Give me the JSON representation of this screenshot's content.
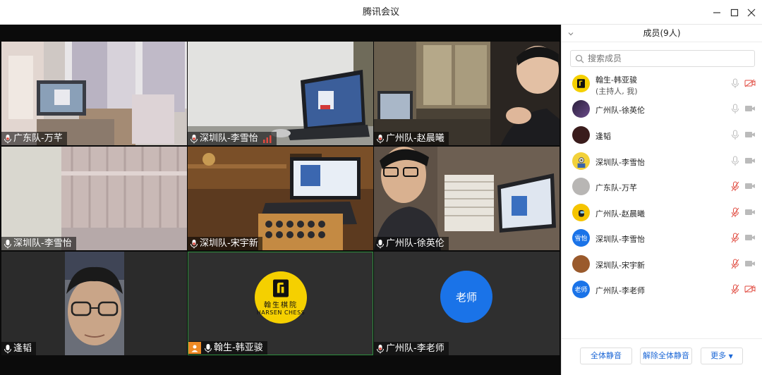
{
  "window": {
    "title": "腾讯会议"
  },
  "tiles": [
    {
      "name": "广东队-万芊",
      "mic": "on",
      "signal": false,
      "kind": "video",
      "scene": "bedroom"
    },
    {
      "name": "深圳队-李雪怡",
      "mic": "on",
      "signal": true,
      "kind": "video",
      "scene": "desk-white"
    },
    {
      "name": "广州队-赵晨曦",
      "mic": "on",
      "signal": false,
      "kind": "video",
      "scene": "person-right"
    },
    {
      "name": "深圳队-李雪怡",
      "mic": "on",
      "signal": false,
      "kind": "video",
      "scene": "curtain"
    },
    {
      "name": "深圳队-宋宇新",
      "mic": "on",
      "signal": false,
      "kind": "video",
      "scene": "desk-warm"
    },
    {
      "name": "广州队-徐英伦",
      "mic": "on",
      "signal": false,
      "kind": "video",
      "scene": "person-left"
    },
    {
      "name": "逢韬",
      "mic": "on",
      "signal": false,
      "kind": "video",
      "scene": "face"
    },
    {
      "name": "翰生-韩亚骏",
      "mic": "on",
      "signal": false,
      "kind": "avatar-brand",
      "brand_cn": "翰生棋院",
      "brand_en": "HARSEN CHESS",
      "host_badge": true
    },
    {
      "name": "广州队-李老师",
      "mic": "on",
      "signal": false,
      "kind": "avatar-text",
      "avatar_text": "老师"
    }
  ],
  "panel": {
    "title": "成员(9人)",
    "search_placeholder": "搜索成员",
    "members": [
      {
        "name": "翰生-韩亚骏",
        "sub": "(主持人, 我)",
        "avatar": "brand",
        "mic": "on",
        "cam": "off"
      },
      {
        "name": "广州队-徐英伦",
        "sub": "",
        "avatar": "dark-purple",
        "mic": "on",
        "cam": "on"
      },
      {
        "name": "逢韬",
        "sub": "",
        "avatar": "dark-red",
        "mic": "on",
        "cam": "on"
      },
      {
        "name": "深圳队-李雪怡",
        "sub": "",
        "avatar": "minion",
        "mic": "on",
        "cam": "on"
      },
      {
        "name": "广东队-万芊",
        "sub": "",
        "avatar": "photo-gray",
        "mic": "off",
        "cam": "on"
      },
      {
        "name": "广州队-赵晨曦",
        "sub": "",
        "avatar": "amongus",
        "mic": "off",
        "cam": "on"
      },
      {
        "name": "深圳队-李雪怡",
        "sub": "",
        "avatar": "text-blue",
        "avatar_text": "雪怡",
        "mic": "off",
        "cam": "on"
      },
      {
        "name": "深圳队-宋宇新",
        "sub": "",
        "avatar": "photo-food",
        "mic": "off",
        "cam": "on"
      },
      {
        "name": "广州队-李老师",
        "sub": "",
        "avatar": "text-blue",
        "avatar_text": "老师",
        "mic": "off",
        "cam": "off"
      }
    ],
    "buttons": {
      "mute_all": "全体静音",
      "unmute_all": "解除全体静音",
      "more": "更多"
    }
  },
  "colors": {
    "accent": "#1a66d6",
    "muted_red": "#e04a3f",
    "avatar_blue": "#1a73e8",
    "brand_yellow": "#f5d000"
  }
}
